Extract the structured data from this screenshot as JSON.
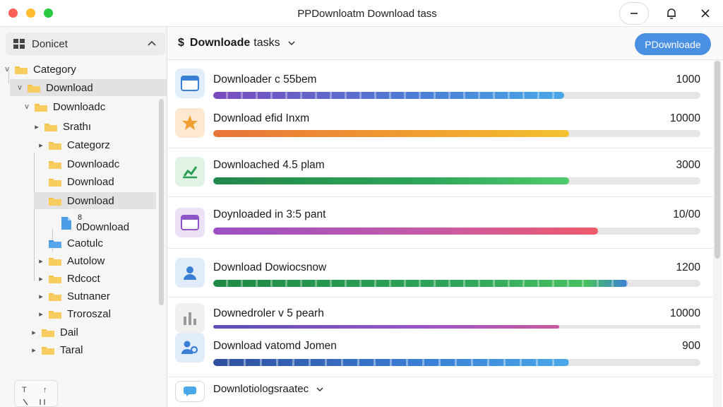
{
  "window": {
    "title": "PPDownloatm Download tass"
  },
  "sidebar": {
    "header": "Donicet",
    "tree": [
      {
        "label": "Category"
      },
      {
        "label": "Download"
      },
      {
        "label": "Downloadc"
      },
      {
        "label": "Srathı"
      },
      {
        "label": "Categorz"
      },
      {
        "label": "Downloadc"
      },
      {
        "label": "Download"
      },
      {
        "label": "Download"
      },
      {
        "label": "0Download",
        "badge": "8"
      },
      {
        "label": "Caotulc"
      },
      {
        "label": "Autolow"
      },
      {
        "label": "Rdcoct"
      },
      {
        "label": "Sutnaner"
      },
      {
        "label": "Troroszal"
      },
      {
        "label": "Dail"
      },
      {
        "label": "Taral"
      }
    ]
  },
  "main": {
    "header": {
      "title_bold": "Downloade",
      "title_rest": "tasks",
      "button": "PDownloade"
    },
    "tasks": [
      {
        "name": "Downloader c 55bem",
        "count": "1000",
        "icon": "window-icon",
        "progress": 0.72
      },
      {
        "name": "Download efid Inxm",
        "count": "10000",
        "icon": "star-icon",
        "progress": 0.73
      },
      {
        "name": "Downloached 4.5 plam",
        "count": "3000",
        "icon": "chart-check-icon",
        "progress": 0.73
      },
      {
        "name": "Doynloaded in 3:5 pant",
        "count": "10/00",
        "icon": "browser-icon",
        "progress": 0.79
      },
      {
        "name": "Download Dowiocsnow",
        "count": "1200",
        "icon": "user-icon",
        "progress": 0.85
      },
      {
        "name": "Downedroler v 5 pearh",
        "count": "10000",
        "icon": "bar-chart-icon",
        "progress": 0.71
      },
      {
        "name": "Download vatomd Jomen",
        "count": "900",
        "icon": "users-gear-icon",
        "progress": 0.73
      }
    ],
    "footer": {
      "label": "Downlotiologsraatec"
    }
  },
  "colors": {
    "accent": "#4a90e2",
    "folder": "#f5c04a"
  }
}
